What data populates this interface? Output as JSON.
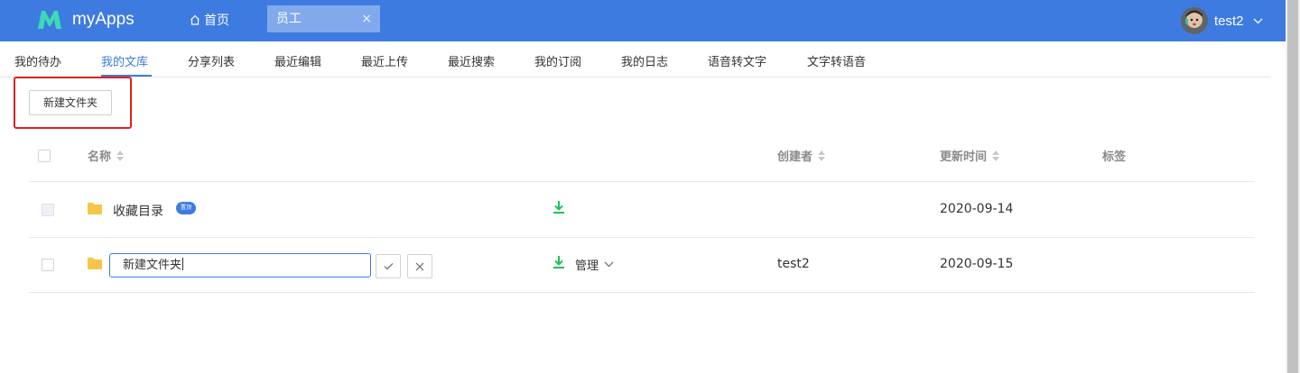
{
  "header": {
    "app_name": "myApps",
    "home_label": "首页",
    "active_tab": "员工",
    "tab_close": "×",
    "user_name": "test2",
    "brand_color": "#3e7be0"
  },
  "subnav": {
    "items": [
      "我的待办",
      "我的文库",
      "分享列表",
      "最近编辑",
      "最近上传",
      "最近搜索",
      "我的订阅",
      "我的日志",
      "语音转文字",
      "文字转语音"
    ],
    "active_index": 1
  },
  "toolbar": {
    "new_folder_label": "新建文件夹"
  },
  "table": {
    "headers": {
      "name": "名称",
      "creator": "创建者",
      "updated": "更新时间",
      "tags": "标签"
    },
    "rows": [
      {
        "name": "收藏目录",
        "badge": "置顶",
        "creator": "",
        "updated": "2020-09-14",
        "checkbox_disabled": true
      },
      {
        "edit_value": "新建文件夹",
        "manage_label": "管理",
        "creator": "test2",
        "updated": "2020-09-15",
        "checkbox_disabled": false
      }
    ]
  },
  "icons": {
    "download": "download-icon",
    "folder": "folder-icon",
    "confirm": "check-icon",
    "cancel": "close-icon"
  },
  "colors": {
    "download_green": "#1fbf5c",
    "folder_yellow": "#f7c548",
    "highlight_red": "#e02020"
  }
}
